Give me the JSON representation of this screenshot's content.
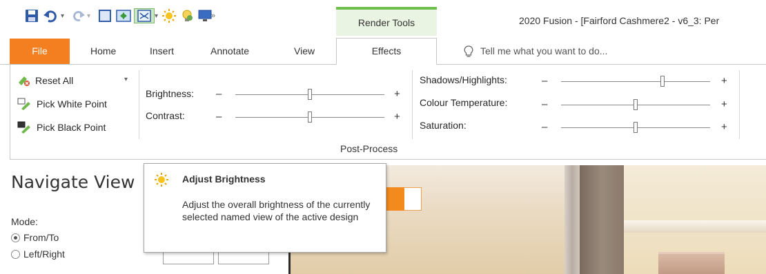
{
  "quick_access": {
    "icons": [
      "save-icon",
      "undo-icon",
      "redo-icon",
      "window-icon",
      "view-switch-icon",
      "render-icon",
      "brightness-icon",
      "lightbulb-icon",
      "monitor-icon",
      "more-icon"
    ],
    "more_glyph": "»"
  },
  "contextual_tab": {
    "label": "Render Tools",
    "color": "#6cbf4a"
  },
  "window": {
    "title": "2020 Fusion - [Fairford Cashmere2 - v6_3: Per"
  },
  "tabs": {
    "file": "File",
    "home": "Home",
    "insert": "Insert",
    "annotate": "Annotate",
    "view": "View",
    "effects": "Effects"
  },
  "tell_me": {
    "placeholder": "Tell me what you want to do..."
  },
  "ribbon": {
    "reset_all": "Reset All",
    "pick_white": "Pick White Point",
    "pick_black": "Pick Black Point",
    "brightness": {
      "label": "Brightness:",
      "minus": "–",
      "plus": "+",
      "value": 0.5
    },
    "contrast": {
      "label": "Contrast:",
      "minus": "–",
      "plus": "+",
      "value": 0.5
    },
    "shadows": {
      "label": "Shadows/Highlights:",
      "minus": "–",
      "plus": "+",
      "value": 0.68
    },
    "colour_temp": {
      "label": "Colour Temperature:",
      "minus": "–",
      "plus": "+",
      "value": 0.5
    },
    "saturation": {
      "label": "Saturation:",
      "minus": "–",
      "plus": "+",
      "value": 0.5
    },
    "group_label": "Post-Process"
  },
  "nav_panel": {
    "title": "Navigate View",
    "mode_label": "Mode:",
    "options": [
      "From/To",
      "Left/Right"
    ],
    "selected": "From/To"
  },
  "tooltip": {
    "title": "Adjust Brightness",
    "body": "Adjust the overall brightness of the currently selected named view of the active design"
  },
  "colors": {
    "file_tab": "#f47f20",
    "accent_green": "#6cbf4a"
  }
}
